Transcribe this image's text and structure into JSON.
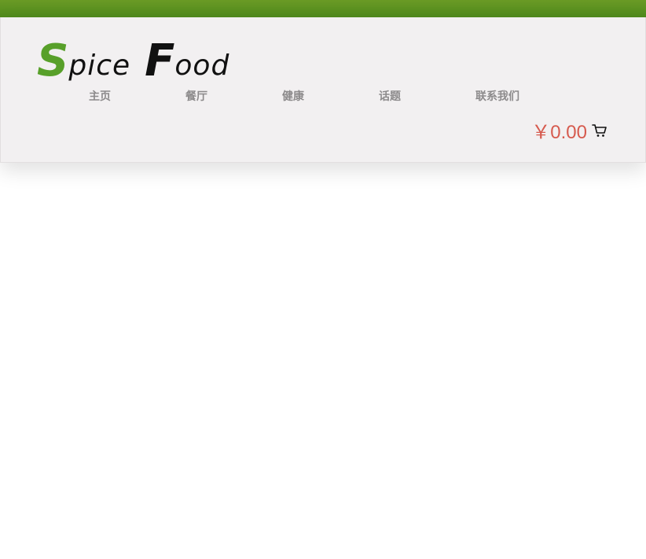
{
  "logo": {
    "word1_cap": "S",
    "word1_rest": "pice",
    "word2_cap": "F",
    "word2_rest": "ood",
    "accent_color": "#58a02a"
  },
  "nav": {
    "items": [
      {
        "label": "主页"
      },
      {
        "label": "餐厅"
      },
      {
        "label": "健康"
      },
      {
        "label": "话题"
      },
      {
        "label": "联系我们"
      }
    ]
  },
  "cart": {
    "total": "￥0.00",
    "total_color": "#d65a4e",
    "icon": "cart-icon"
  },
  "colors": {
    "topbar": "#5a8f20",
    "header_bg": "#f2f0f1",
    "nav_text": "#8c8a8b"
  }
}
